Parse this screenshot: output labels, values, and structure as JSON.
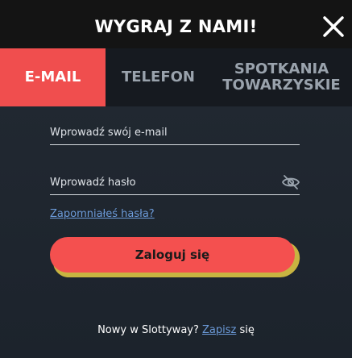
{
  "header": {
    "title": "WYGRAJ Z NAMI!",
    "close_icon": "close-icon"
  },
  "tabs": [
    {
      "label": "E-MAIL",
      "active": true
    },
    {
      "label": "TELEFON",
      "active": false
    },
    {
      "label_line1": "SPOTKANIA",
      "label_line2": "TOWARZYSKIE",
      "active": false
    }
  ],
  "form": {
    "email_placeholder": "Wprowadź swój e-mail",
    "email_value": "",
    "password_placeholder": "Wprowadź hasło",
    "password_value": "",
    "password_toggle_icon": "eye-off-icon",
    "forgot_label": "Zapomniałeś hasła?",
    "login_label": "Zaloguj się"
  },
  "footer": {
    "prefix": "Nowy w Slottyway?",
    "link": "Zapisz",
    "suffix": "się"
  },
  "colors": {
    "accent": "#f04e4e",
    "header_bg": "#141414",
    "link": "#6c9bd9"
  }
}
